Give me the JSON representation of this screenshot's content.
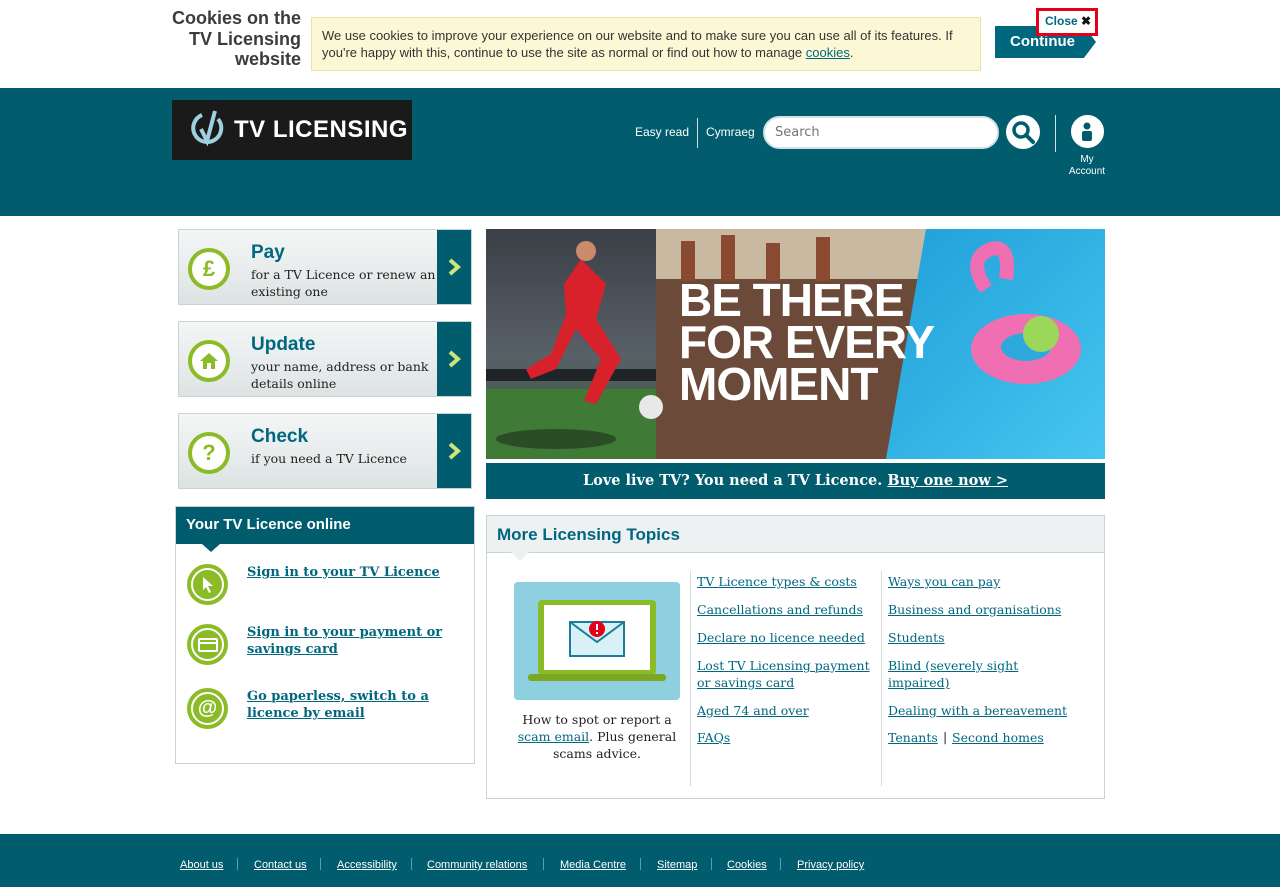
{
  "cookie_banner": {
    "title": "Cookies on the TV Licensing website",
    "message": "We use cookies to improve your experience on our website and to make sure you can use all of its features. If you're happy with this, continue to use the site as normal or find out how to manage ",
    "message_link": "cookies",
    "message_end": ".",
    "continue_label": "Continue",
    "close_label": "Close",
    "close_icon_glyph": "✖"
  },
  "header": {
    "logo_text": "TV LICENSING",
    "easy_read": "Easy read",
    "cymraeg": "Cymraeg",
    "search_placeholder": "Search",
    "account_label": "My Account"
  },
  "tiles": [
    {
      "title": "Pay",
      "desc": "for a TV Licence or renew an existing one",
      "icon": "pound-icon",
      "glyph": "£"
    },
    {
      "title": "Update",
      "desc": "your name, address or bank details online",
      "icon": "house-icon",
      "glyph": ""
    },
    {
      "title": "Check",
      "desc": "if you need a TV Licence",
      "icon": "question-icon",
      "glyph": "?"
    }
  ],
  "online": {
    "heading": "Your TV Licence online",
    "items": [
      {
        "label": "Sign in to your TV Licence",
        "icon": "cursor-icon"
      },
      {
        "label": "Sign in to your payment or savings card",
        "icon": "card-icon"
      },
      {
        "label": "Go paperless, switch to a licence by email",
        "icon": "at-icon"
      }
    ]
  },
  "hero": {
    "headline_1": "BE THERE",
    "headline_2": "FOR EVERY",
    "headline_3": "MOMENT",
    "caption": "Love live TV? You need a TV Licence. ",
    "caption_link": "Buy one now >"
  },
  "topics": {
    "heading": "More Licensing Topics",
    "scam_pre": "How to spot or report a ",
    "scam_link": "scam email",
    "scam_post": ". Plus general scams advice.",
    "col1": [
      "TV Licence types & costs",
      "Cancellations and refunds",
      "Declare no licence needed",
      "Lost TV Licensing payment or savings card",
      "Aged 74 and over",
      "FAQs"
    ],
    "col2": [
      "Ways you can pay",
      "Business and organisations",
      "Students",
      "Blind (severely sight impaired)",
      "Dealing with a bereavement",
      "Tenants",
      "Second homes"
    ],
    "pipe": "|"
  },
  "footer": {
    "links": [
      "About us",
      "Contact us",
      "Accessibility",
      "Community relations",
      "Media Centre",
      "Sitemap",
      "Cookies",
      "Privacy policy"
    ]
  },
  "colors": {
    "brand_teal": "#015c6e",
    "link_teal": "#00677f",
    "accent_green": "#8cbb28",
    "close_red": "#e2001a",
    "cookie_bg": "#fcf8d6"
  }
}
